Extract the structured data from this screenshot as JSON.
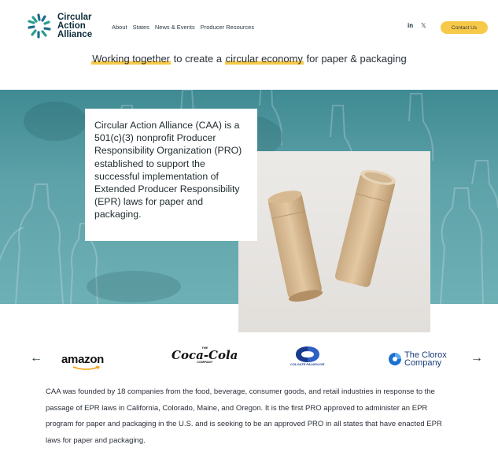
{
  "brand": {
    "name_line1": "Circular",
    "name_line2": "Action",
    "name_line3": "Alliance",
    "logo_icon": "circular-swirl-logo-icon"
  },
  "nav": {
    "items": [
      {
        "label": "About"
      },
      {
        "label": "States"
      },
      {
        "label": "News & Events"
      },
      {
        "label": "Producer Resources"
      }
    ]
  },
  "social": {
    "linkedin": "in",
    "x": "𝕏"
  },
  "header": {
    "contact_label": "Contact Us"
  },
  "tagline": {
    "part1": "Working together",
    "part2": " to create a ",
    "part3": "circular economy",
    "part4": " for paper & packaging"
  },
  "hero": {
    "text": "Circular Action Alliance (CAA) is a 501(c)(3) nonprofit Producer Responsibility Organization (PRO) established to support the successful implementation of Extended Producer Responsibility (EPR) laws for paper and packaging."
  },
  "carousel": {
    "prev_icon": "arrow-left-icon",
    "next_icon": "arrow-right-icon",
    "prev": "←",
    "next": "→",
    "amazon": "amazon",
    "coke_top": "THE",
    "coke_script": "Coca-Cola",
    "coke_bottom": "COMPANY",
    "colgate_text": "COLGATE PALMOLIVE",
    "clorox_line1": "The Clorox",
    "clorox_line2": "Company"
  },
  "about": {
    "text": "CAA was founded by 18 companies from the food, beverage, consumer goods, and retail industries in response to the passage of EPR laws in California, Colorado, Maine, and Oregon. It is the first PRO approved to administer an EPR program for paper and packaging in the U.S. and is seeking to be an approved PRO in all states that have enacted EPR laws for paper and packaging."
  },
  "colors": {
    "accent": "#f7c948",
    "hero_teal": "#5fa3aa",
    "navy": "#0f2c3a"
  }
}
